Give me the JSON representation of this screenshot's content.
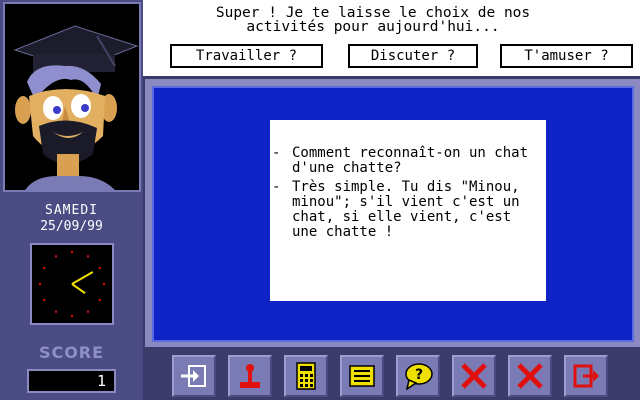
{
  "dialogue": {
    "message_line1": "Super ! Je te laisse le choix de nos",
    "message_line2": "activités pour aujourd'hui...",
    "choices": [
      "Travailler ?",
      "Discuter ?",
      "T'amuser ?"
    ]
  },
  "status": {
    "day": "SAMEDI",
    "date": "25/09/99",
    "score_label": "SCORE",
    "score_value": "1",
    "clock": {
      "hour": 4,
      "minute": 10
    }
  },
  "joke": {
    "dash": "-",
    "question": "Comment reconnaît-on un chat d'une chatte?",
    "answer": "Très simple. Tu dis \"Minou, minou\"; s'il vient c'est un chat, si elle vient, c'est une chatte !"
  },
  "toolbar": {
    "icons": [
      "exit-door-icon",
      "joystick-icon",
      "calculator-icon",
      "notepad-icon",
      "question-bubble-icon",
      "close-icon",
      "close-icon",
      "quit-icon"
    ]
  },
  "colors": {
    "main_blue": "#0e22c6",
    "panel": "#4c4c84",
    "clock_marks": "#e01010",
    "clock_hand": "#f0e000"
  }
}
